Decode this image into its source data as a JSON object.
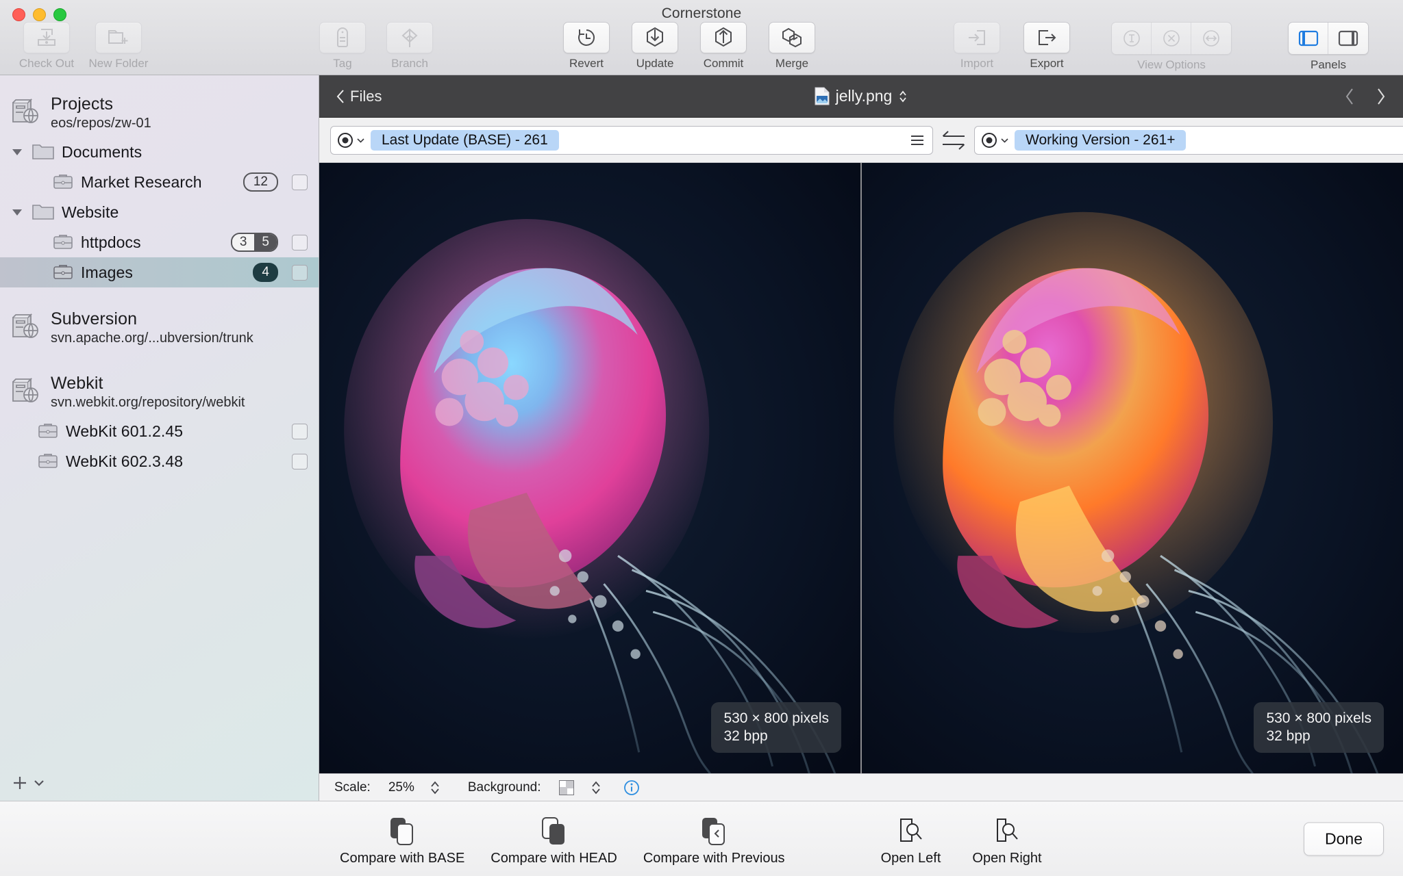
{
  "window": {
    "title": "Cornerstone",
    "traffic_lights": [
      "close-red",
      "minimize-yellow",
      "zoom-green"
    ]
  },
  "toolbar": {
    "left_group": [
      {
        "label": "Check Out",
        "icon": "checkout-icon",
        "enabled": false
      },
      {
        "label": "New Folder",
        "icon": "new-folder-icon",
        "enabled": false
      }
    ],
    "tag_group": [
      {
        "label": "Tag",
        "icon": "tag-icon",
        "enabled": false
      },
      {
        "label": "Branch",
        "icon": "branch-icon",
        "enabled": false
      }
    ],
    "action_group": [
      {
        "label": "Revert",
        "icon": "revert-clock-icon",
        "enabled": true
      },
      {
        "label": "Update",
        "icon": "update-download-icon",
        "enabled": true
      },
      {
        "label": "Commit",
        "icon": "commit-upload-icon",
        "enabled": true
      },
      {
        "label": "Merge",
        "icon": "merge-hexagons-icon",
        "enabled": true
      }
    ],
    "io_group": [
      {
        "label": "Import",
        "icon": "import-arrow-icon",
        "enabled": false
      },
      {
        "label": "Export",
        "icon": "export-arrow-icon",
        "enabled": true
      }
    ],
    "view_options": {
      "label": "View Options",
      "segments": [
        "text-option-icon",
        "ignore-option-icon",
        "whitespace-option-icon"
      ],
      "enabled": false
    },
    "panels": {
      "label": "Panels",
      "segments": [
        "left-panel-icon",
        "right-panel-icon"
      ],
      "left_active": true,
      "accent": "#1f7ce0"
    }
  },
  "sidebar": {
    "repos": [
      {
        "name": "Projects",
        "path": "eos/repos/zw-01",
        "icon": "repository-icon",
        "children": [
          {
            "label": "Documents",
            "icon": "folder-icon",
            "indent": "group",
            "disclosure": "open"
          },
          {
            "label": "Market Research",
            "icon": "briefcase-icon",
            "indent": "child",
            "badge": {
              "type": "single",
              "value": "12",
              "style": "outline"
            },
            "checkbox": true
          },
          {
            "label": "Website",
            "icon": "folder-icon",
            "indent": "group",
            "disclosure": "open"
          },
          {
            "label": "httpdocs",
            "icon": "briefcase-icon",
            "indent": "child",
            "badge": {
              "type": "split",
              "left": "3",
              "right": "5"
            },
            "checkbox": true
          },
          {
            "label": "Images",
            "icon": "briefcase-icon",
            "indent": "child",
            "badge": {
              "type": "single",
              "value": "4",
              "style": "dark"
            },
            "checkbox": true,
            "selected": true
          }
        ]
      },
      {
        "name": "Subversion",
        "path": "svn.apache.org/...ubversion/trunk",
        "icon": "repository-icon",
        "children": []
      },
      {
        "name": "Webkit",
        "path": "svn.webkit.org/repository/webkit",
        "icon": "repository-icon",
        "children": [
          {
            "label": "WebKit 601.2.45",
            "icon": "briefcase-icon",
            "indent": "working-copy",
            "checkbox": true
          },
          {
            "label": "WebKit 602.3.48",
            "icon": "briefcase-icon",
            "indent": "working-copy",
            "checkbox": true
          }
        ]
      }
    ],
    "footer": {
      "add_icon": "plus-icon",
      "menu_icon": "chevron-down-icon"
    }
  },
  "file_bar": {
    "back_label": "Files",
    "back_icon": "chevron-left-icon",
    "file_name": "jelly.png",
    "file_icon": "image-file-icon",
    "file_stepper_icon": "up-down-chevrons-icon",
    "prev_icon": "chevron-left-icon",
    "next_icon": "chevron-right-icon"
  },
  "version_bar": {
    "left": {
      "radio_icon": "radio-dot-icon",
      "dropdown_icon": "chevron-down-small-icon",
      "value": "Last Update (BASE) - 261",
      "menu_icon": "hamburger-menu-icon",
      "pill_color": "#b9d6f7"
    },
    "swap_icon": "swap-arrows-icon",
    "right": {
      "radio_icon": "radio-dot-icon",
      "dropdown_icon": "chevron-down-small-icon",
      "value": "Working Version - 261+",
      "menu_icon": "hamburger-menu-icon",
      "pill_color": "#b9d6f7"
    }
  },
  "panes": {
    "left": {
      "info_line1": "530 × 800 pixels",
      "info_line2": "32 bpp",
      "image": "jellyfish-pink-purple"
    },
    "right": {
      "info_line1": "530 × 800 pixels",
      "info_line2": "32 bpp",
      "image": "jellyfish-orange-magenta"
    }
  },
  "status_bar": {
    "scale_label": "Scale:",
    "scale_value": "25%",
    "scale_stepper_icon": "up-down-chevrons-icon",
    "background_label": "Background:",
    "background_swatch_icon": "checker-swatch-icon",
    "background_stepper_icon": "up-down-chevrons-icon",
    "info_icon": "info-circle-icon",
    "info_color": "#2f8fe0"
  },
  "bottom_bar": {
    "compare_buttons": [
      {
        "label": "Compare with BASE",
        "icon": "compare-base-icon"
      },
      {
        "label": "Compare with HEAD",
        "icon": "compare-head-icon"
      },
      {
        "label": "Compare with Previous",
        "icon": "compare-previous-icon"
      }
    ],
    "open_buttons": [
      {
        "label": "Open Left",
        "icon": "open-left-magnifier-icon"
      },
      {
        "label": "Open Right",
        "icon": "open-right-magnifier-icon"
      }
    ],
    "done_label": "Done"
  }
}
